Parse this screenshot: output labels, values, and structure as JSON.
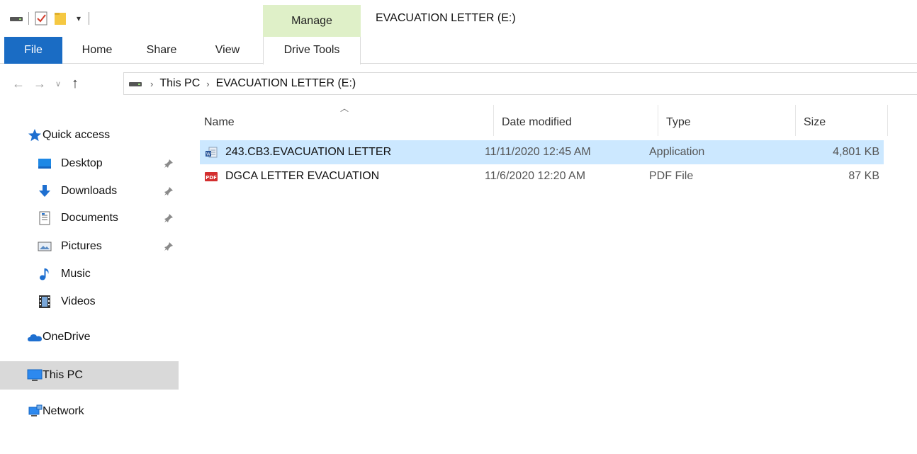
{
  "window": {
    "title": "EVACUATION LETTER (E:)",
    "context_tab_group": "Manage"
  },
  "ribbon": {
    "tabs": [
      {
        "label": "File",
        "active": true
      },
      {
        "label": "Home"
      },
      {
        "label": "Share"
      },
      {
        "label": "View"
      },
      {
        "label": "Drive Tools"
      }
    ]
  },
  "address": {
    "breadcrumb": [
      "This PC",
      "EVACUATION LETTER (E:)"
    ]
  },
  "sidebar": {
    "items": [
      {
        "label": "Quick access",
        "icon": "star-icon"
      },
      {
        "label": "Desktop",
        "icon": "desktop-folder-icon",
        "pinned": true
      },
      {
        "label": "Downloads",
        "icon": "downloads-icon",
        "pinned": true
      },
      {
        "label": "Documents",
        "icon": "documents-icon",
        "pinned": true
      },
      {
        "label": "Pictures",
        "icon": "pictures-icon",
        "pinned": true
      },
      {
        "label": "Music",
        "icon": "music-icon"
      },
      {
        "label": "Videos",
        "icon": "videos-icon"
      },
      {
        "label": "OneDrive",
        "icon": "onedrive-icon"
      },
      {
        "label": "This PC",
        "icon": "computer-icon",
        "selected": true
      },
      {
        "label": "Network",
        "icon": "network-icon"
      }
    ]
  },
  "file_list": {
    "columns": [
      "Name",
      "Date modified",
      "Type",
      "Size"
    ],
    "sort_column": "Name",
    "rows": [
      {
        "name": "243.CB3.EVACUATION LETTER",
        "date": "11/11/2020 12:45 AM",
        "type": "Application",
        "size": "4,801 KB",
        "icon": "application-icon",
        "selected": true
      },
      {
        "name": "DGCA LETTER EVACUATION",
        "date": "11/6/2020 12:20 AM",
        "type": "PDF File",
        "size": "87 KB",
        "icon": "pdf-icon",
        "selected": false
      }
    ]
  },
  "colors": {
    "file_tab": "#1a6cc4",
    "manage_tab": "#dff0c8",
    "selected_row": "#cce8ff",
    "sidebar_selected": "#d9d9d9"
  }
}
